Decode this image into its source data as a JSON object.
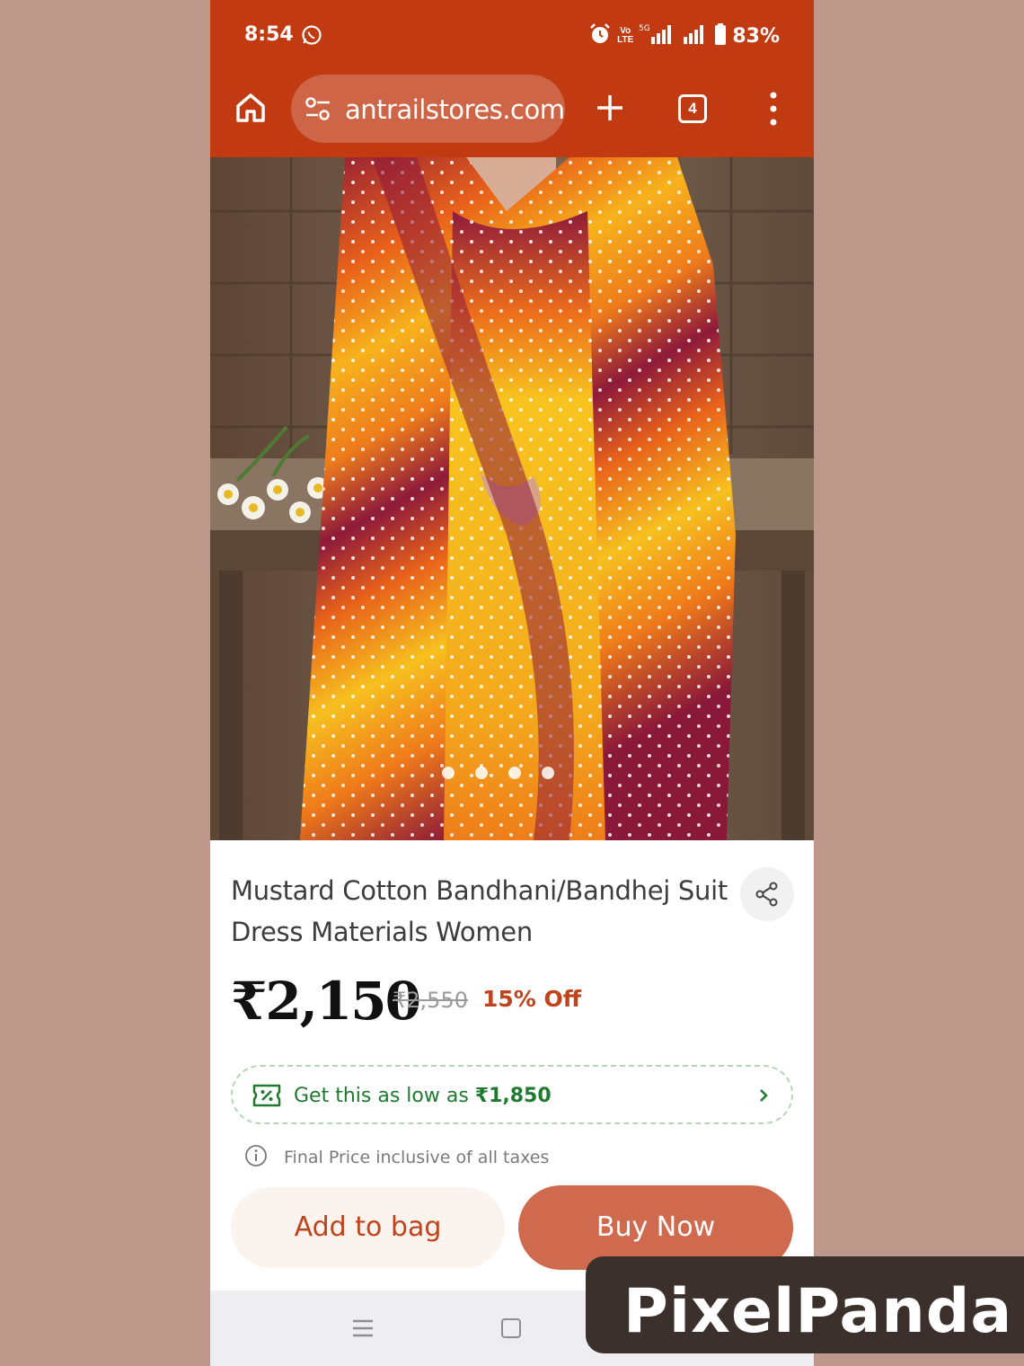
{
  "status_bar": {
    "time": "8:54",
    "battery": "83%",
    "network_label_top": "Vo",
    "network_label_bottom": "LTE",
    "signal_label": "5G"
  },
  "browser": {
    "url": "antrailstores.com",
    "tab_count": "4"
  },
  "product": {
    "title": "Mustard Cotton Bandhani/Bandhej Suit Dress Materials Women",
    "price": "₹2,150",
    "mrp": "₹2,550",
    "discount": "15% Off",
    "image_count": 4
  },
  "offer": {
    "prefix": "Get this as low as ",
    "amount": "₹1,850"
  },
  "tax_note": "Final Price inclusive of all taxes",
  "actions": {
    "add_to_bag": "Add to bag",
    "buy_now": "Buy Now"
  },
  "watermark": "PixelPanda",
  "colors": {
    "brand": "#c13a12",
    "accent": "#d06a4e",
    "offer_green": "#1e7a2f",
    "discount_red": "#c0431c",
    "page_background": "#bd9789"
  },
  "icons": [
    "whatsapp-icon",
    "alarm-icon",
    "signal-icon",
    "battery-icon",
    "home-icon",
    "site-settings-icon",
    "plus-icon",
    "tab-switcher-icon",
    "more-vert-icon",
    "share-icon",
    "offer-coupon-icon",
    "chevron-right-icon",
    "info-icon",
    "nav-recents-icon",
    "nav-home-icon",
    "nav-back-icon"
  ]
}
